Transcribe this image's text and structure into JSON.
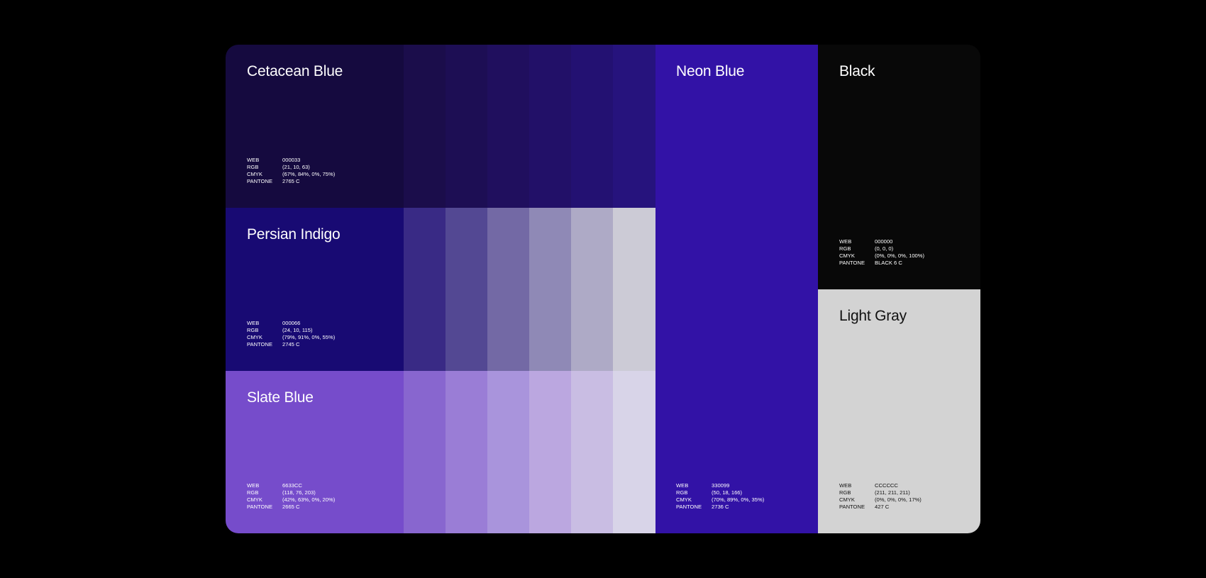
{
  "swatches": {
    "cetacean": {
      "name": "Cetacean Blue",
      "color": "#150A3F",
      "specs": [
        {
          "label": "WEB",
          "value": "000033"
        },
        {
          "label": "RGB",
          "value": "(21, 10, 63)"
        },
        {
          "label": "CMYK",
          "value": "(67%, 84%, 0%, 75%)"
        },
        {
          "label": "PANTONE",
          "value": "2765 C"
        }
      ],
      "tints": [
        "#1B0D4B",
        "#1D0E54",
        "#200F5E",
        "#221068",
        "#231172",
        "#26137D"
      ]
    },
    "persian": {
      "name": "Persian Indigo",
      "color": "#180A73",
      "specs": [
        {
          "label": "WEB",
          "value": "000066"
        },
        {
          "label": "RGB",
          "value": "(24, 10, 115)"
        },
        {
          "label": "CMYK",
          "value": "(79%, 91%, 0%, 55%)"
        },
        {
          "label": "PANTONE",
          "value": "2745 C"
        }
      ],
      "tints": [
        "#392A85",
        "#534893",
        "#7369A5",
        "#8F89B6",
        "#AEAAC6",
        "#CCCBD6"
      ]
    },
    "slate": {
      "name": "Slate Blue",
      "color": "#764CCB",
      "specs": [
        {
          "label": "WEB",
          "value": "6633CC"
        },
        {
          "label": "RGB",
          "value": "(118, 76, 203)"
        },
        {
          "label": "CMYK",
          "value": "(42%, 63%, 0%, 20%)"
        },
        {
          "label": "PANTONE",
          "value": "2665 C"
        }
      ],
      "tints": [
        "#8866CF",
        "#9A7DD6",
        "#A994DC",
        "#BBA7E0",
        "#C9BDE3",
        "#D8D4E8"
      ]
    },
    "neon": {
      "name": "Neon Blue",
      "color": "#3212A6",
      "specs": [
        {
          "label": "WEB",
          "value": "330099"
        },
        {
          "label": "RGB",
          "value": "(50, 18, 166)"
        },
        {
          "label": "CMYK",
          "value": "(70%, 89%, 0%, 35%)"
        },
        {
          "label": "PANTONE",
          "value": "2736 C"
        }
      ]
    },
    "black": {
      "name": "Black",
      "color": "#080808",
      "specs": [
        {
          "label": "WEB",
          "value": "000000"
        },
        {
          "label": "RGB",
          "value": "(0, 0, 0)"
        },
        {
          "label": "CMYK",
          "value": "(0%, 0%, 0%, 100%)"
        },
        {
          "label": "PANTONE",
          "value": "BLACK 6 C"
        }
      ]
    },
    "lightgray": {
      "name": "Light Gray",
      "color": "#D3D3D3",
      "specs": [
        {
          "label": "WEB",
          "value": "CCCCCC"
        },
        {
          "label": "RGB",
          "value": "(211, 211, 211)"
        },
        {
          "label": "CMYK",
          "value": "(0%, 0%, 0%, 17%)"
        },
        {
          "label": "PANTONE",
          "value": "427 C"
        }
      ]
    }
  }
}
